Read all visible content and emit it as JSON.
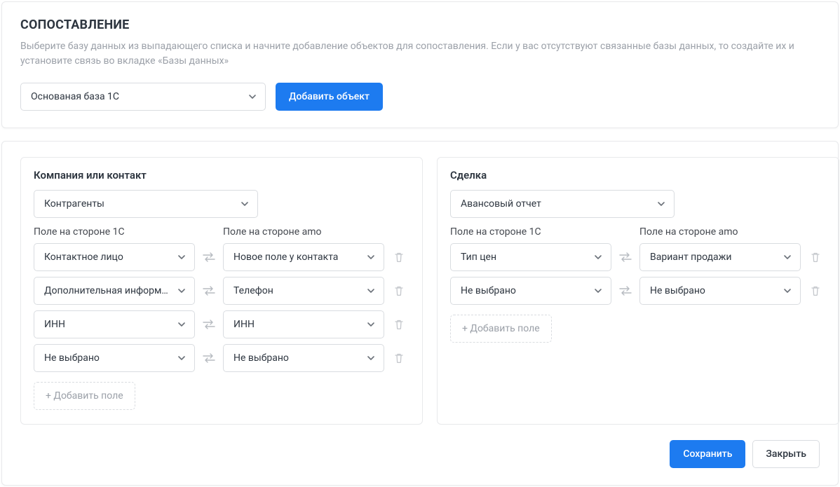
{
  "header": {
    "title": "СОПОСТАВЛЕНИЕ",
    "subtitle": "Выберите базу данных из выпадающего списка и начните добавление объектов для сопоставления. Если у вас отсутствуют связанные базы данных, то создайте их и установите связь во вкладке «Базы данных»",
    "db_select": "Основаная база 1С",
    "add_object_label": "Добавить объект"
  },
  "labels": {
    "field_1c": "Поле на стороне 1С",
    "field_amo": "Поле на стороне amo",
    "add_field": "+ Добавить поле"
  },
  "objects": [
    {
      "title": "Компания или контакт",
      "main_select": "Контрагенты",
      "rows": [
        {
          "left": "Контактное лицо",
          "right": "Новое поле у контакта"
        },
        {
          "left": "Дополнительная информ…",
          "right": "Телефон"
        },
        {
          "left": "ИНН",
          "right": "ИНН"
        },
        {
          "left": "Не выбрано",
          "right": "Не выбрано"
        }
      ]
    },
    {
      "title": "Сделка",
      "main_select": "Авансовый отчет",
      "rows": [
        {
          "left": "Тип цен",
          "right": "Вариант продажи"
        },
        {
          "left": "Не выбрано",
          "right": "Не выбрано"
        }
      ]
    }
  ],
  "footer": {
    "save": "Сохранить",
    "close": "Закрыть"
  }
}
